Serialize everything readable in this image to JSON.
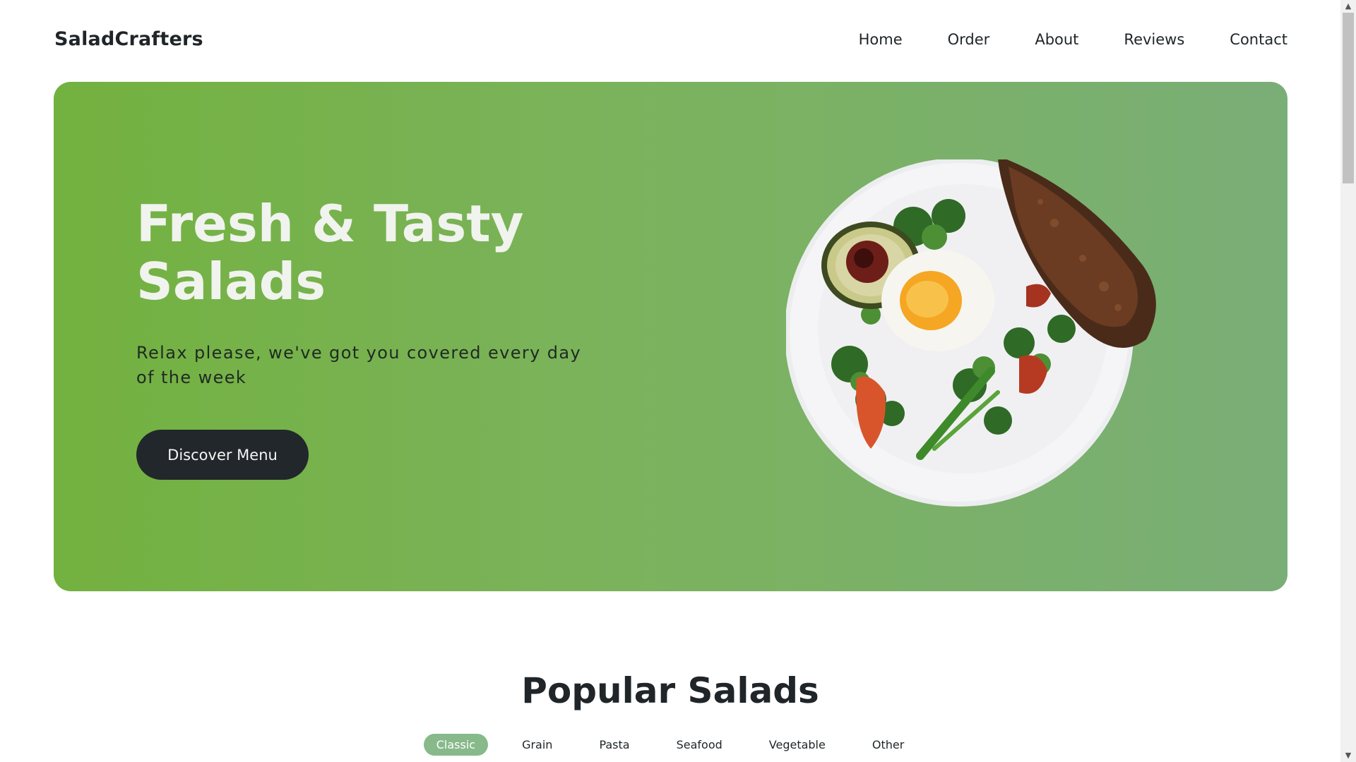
{
  "brand": {
    "name": "SaladCrafters"
  },
  "nav": [
    {
      "label": "Home"
    },
    {
      "label": "Order"
    },
    {
      "label": "About"
    },
    {
      "label": "Reviews"
    },
    {
      "label": "Contact"
    }
  ],
  "hero": {
    "title_line1": "Fresh & Tasty",
    "title_line2": "Salads",
    "subtitle": "Relax please, we've got you covered every day of the week",
    "cta_label": "Discover Menu"
  },
  "popular": {
    "title": "Popular Salads",
    "filters": [
      {
        "label": "Classic",
        "active": true
      },
      {
        "label": "Grain",
        "active": false
      },
      {
        "label": "Pasta",
        "active": false
      },
      {
        "label": "Seafood",
        "active": false
      },
      {
        "label": "Vegetable",
        "active": false
      },
      {
        "label": "Other",
        "active": false
      }
    ]
  },
  "colors": {
    "hero_start": "#73b13f",
    "hero_end": "#7aae77",
    "button_dark": "#22272b",
    "filter_active": "#87b98a",
    "text_dark": "#1f2528"
  }
}
